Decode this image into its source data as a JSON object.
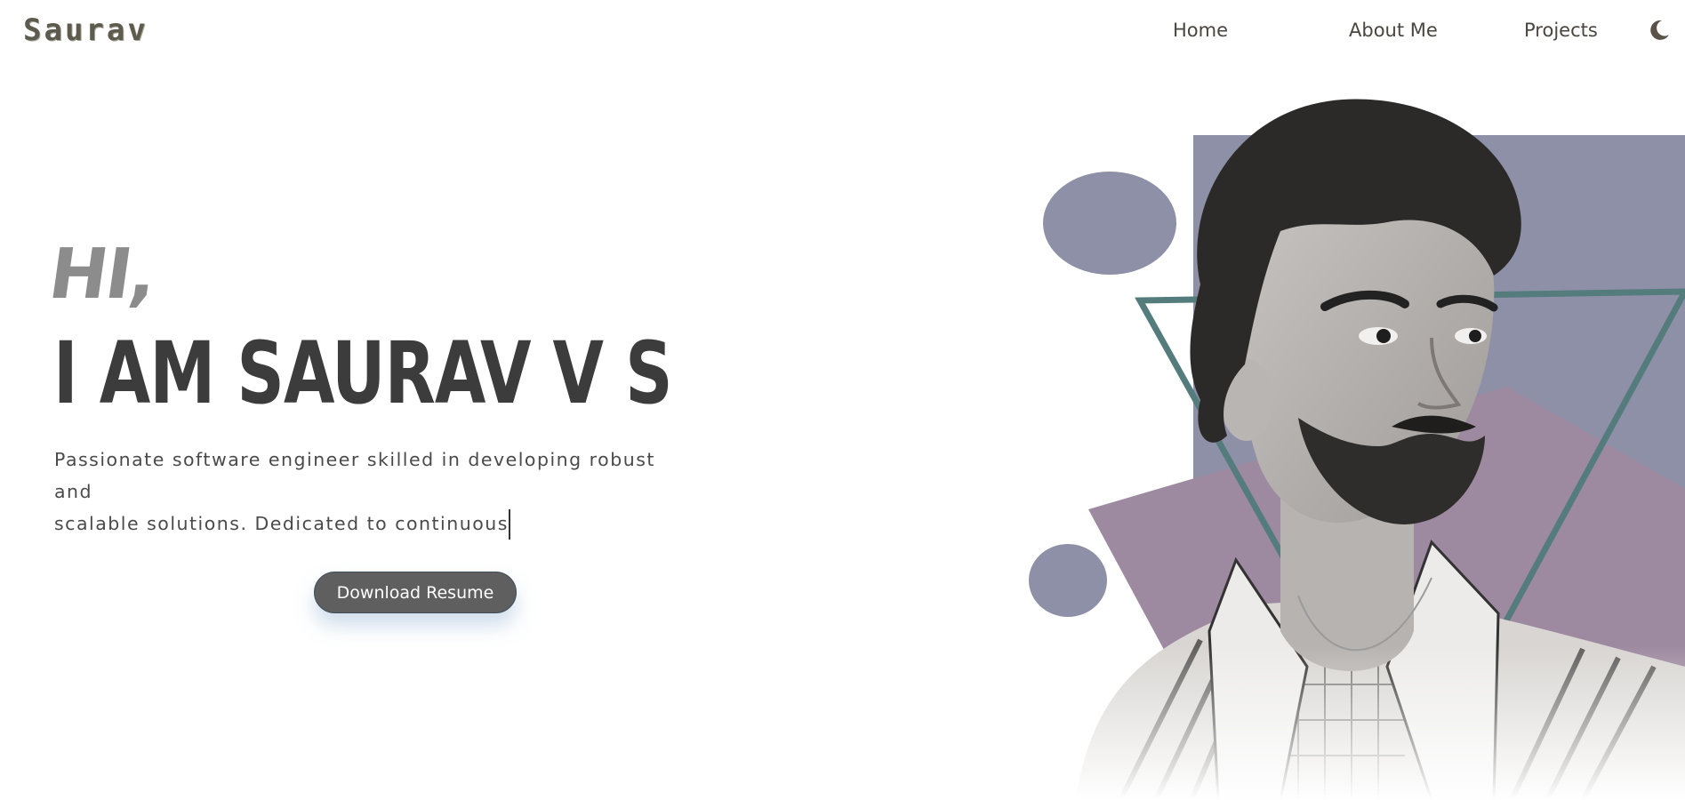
{
  "header": {
    "logo": "Saurav",
    "nav": [
      {
        "label": "Home"
      },
      {
        "label": "About Me"
      },
      {
        "label": "Projects"
      }
    ],
    "theme_toggle_icon": "moon-icon"
  },
  "hero": {
    "greeting": "HI,",
    "headline": "I AM SAURAV V S",
    "subtitle_line1": "Passionate software engineer skilled in developing robust and",
    "subtitle_line2": "scalable solutions. Dedicated to continuous",
    "download_button": "Download Resume",
    "portrait_description_icon": "portrait-photo"
  },
  "colors": {
    "text_dark": "#3c3c3c",
    "nav_text": "#4a453e",
    "button_bg": "#5f5f5f",
    "shape_slate": "#8e90a8",
    "shape_mauve": "#9e8aa0",
    "shape_teal": "#557c7c"
  }
}
